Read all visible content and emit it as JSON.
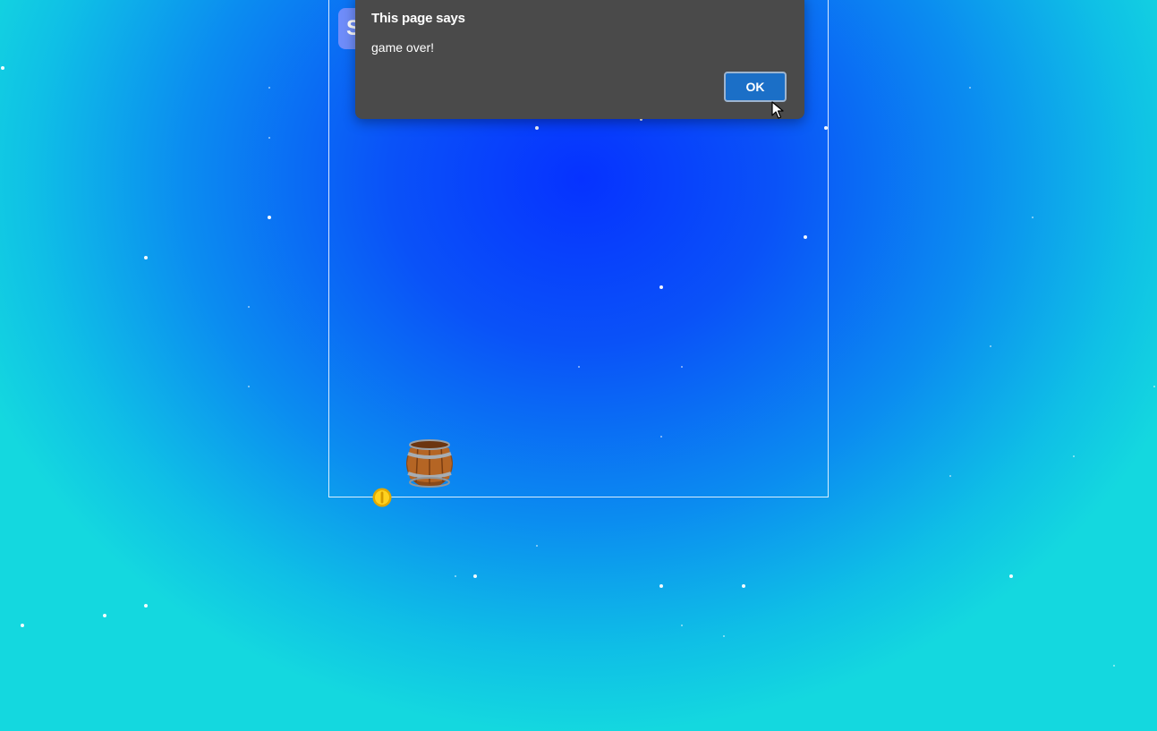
{
  "game": {
    "score_partial": "S"
  },
  "dialog": {
    "title": "This page says",
    "message": "game over!",
    "ok_label": "OK"
  },
  "icons": {
    "barrel": "barrel-icon",
    "coin": "coin-icon",
    "cursor": "mouse-cursor-icon"
  },
  "colors": {
    "background_center": "#0632ff",
    "background_edge": "#14d8df",
    "dialog_bg": "#4a4a4a",
    "ok_button": "#1b6fc7",
    "score_badge": "#6f8dfa"
  }
}
